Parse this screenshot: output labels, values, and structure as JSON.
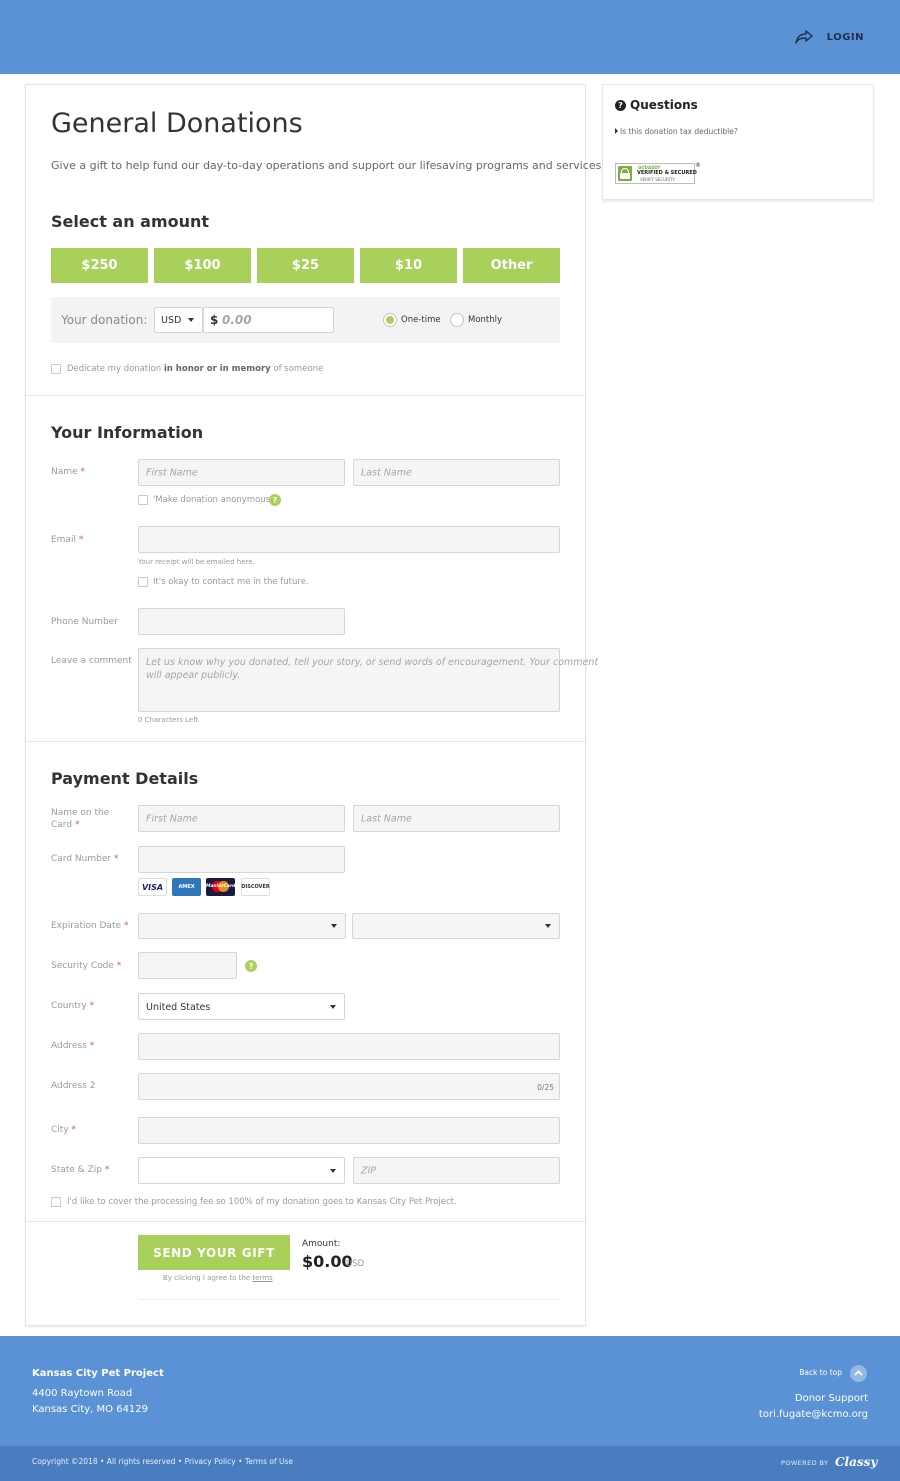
{
  "header": {
    "login_label": "LOGIN"
  },
  "form": {
    "title": "General Donations",
    "description": "Give a gift to help fund our day-to-day operations and support our lifesaving programs and services.",
    "amount_heading": "Select an amount",
    "amounts": [
      "$250",
      "$100",
      "$25",
      "$10",
      "Other"
    ],
    "donation_label": "Your donation:",
    "currency": "USD",
    "currency_symbol": "$",
    "amount_placeholder": "0.00",
    "frequency": {
      "one_time": "One-time",
      "monthly": "Monthly",
      "selected": "One-time"
    },
    "dedicate": {
      "pre": "Dedicate my donation",
      "bold": "in honor or in memory",
      "post": "of someone"
    }
  },
  "info": {
    "heading": "Your Information",
    "name_label": "Name",
    "first_name_placeholder": "First Name",
    "last_name_placeholder": "Last Name",
    "anonymous_label": "'Make donation anonymous'",
    "email_label": "Email",
    "email_help": "Your receipt will be emailed here.",
    "contact_label": "It's okay to contact me in the future.",
    "phone_label": "Phone Number",
    "comment_label": "Leave a comment",
    "comment_placeholder_1": "Let us know why you donated, tell your story, or send words of encouragement. Your comment",
    "comment_placeholder_2": "will appear publicly.",
    "chars_left": "0 Characters Left"
  },
  "payment": {
    "heading": "Payment Details",
    "card_name_label_1": "Name on the",
    "card_name_label_2": "Card",
    "first_name_placeholder": "First Name",
    "last_name_placeholder": "Last Name",
    "card_number_label": "Card Number",
    "card_brands": [
      "VISA",
      "AMEX",
      "MasterCard",
      "DISCOVER"
    ],
    "expiration_label": "Expiration Date",
    "security_label": "Security Code",
    "country_label": "Country",
    "country_value": "United States",
    "address_label": "Address",
    "address2_label": "Address 2",
    "address2_counter": "0/25",
    "city_label": "City",
    "state_zip_label": "State & Zip",
    "zip_placeholder": "ZIP",
    "fee_label": "I'd like to cover the processing fee so 100% of my donation goes to Kansas City Pet Project."
  },
  "submit": {
    "button_label": "SEND YOUR GIFT",
    "terms_pre": "By clicking I agree to the",
    "terms_link": "terms",
    "amount_label": "Amount:",
    "amount_value": "$0.00",
    "amount_currency": "USD"
  },
  "sidebar": {
    "heading": "Questions",
    "link": "Is this donation tax deductible?",
    "badge": {
      "brand": "GODADDY",
      "main": "VERIFIED & SECURED",
      "sub": "VERIFY SECURITY"
    }
  },
  "footer": {
    "org_name": "Kansas City Pet Project",
    "address_1": "4400 Raytown Road",
    "address_2": "Kansas City, MO 64129",
    "back_to_top": "Back to top",
    "support_label": "Donor Support",
    "support_email": "tori.fugate@kcmo.org",
    "copyright": "Copyright ©2018 • All rights reserved •",
    "privacy": "Privacy Policy",
    "separator": "•",
    "terms": "Terms of Use",
    "powered_by": "POWERED BY",
    "powered_brand": "Classy"
  },
  "colors": {
    "header_blue": "#5b92d6",
    "footer_dark": "#4a7cc0",
    "accent_green": "#a9d05b",
    "required_red": "#d9534f"
  }
}
